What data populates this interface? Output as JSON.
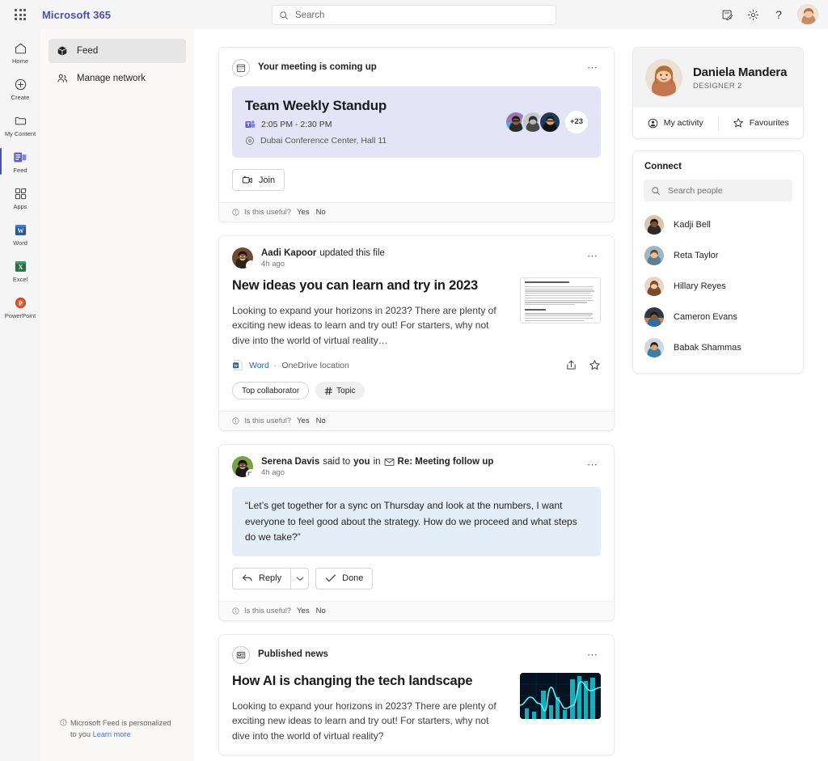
{
  "header": {
    "brand": "Microsoft 365",
    "waffle_label": "app-launcher",
    "search_placeholder": "Search",
    "search_value": "",
    "icons": {
      "feedback": "note-edit-icon",
      "settings": "gear-icon",
      "help": "help-icon",
      "avatar": "user-avatar"
    }
  },
  "rail": {
    "items": [
      {
        "label": "Home",
        "icon": "home-icon"
      },
      {
        "label": "Create",
        "icon": "plus-circle-icon"
      },
      {
        "label": "My Content",
        "icon": "folder-icon"
      },
      {
        "label": "Feed",
        "icon": "feed-icon"
      },
      {
        "label": "Apps",
        "icon": "apps-grid-icon"
      },
      {
        "label": "Word",
        "icon": "word-icon"
      },
      {
        "label": "Excel",
        "icon": "excel-icon"
      },
      {
        "label": "PowerPoint",
        "icon": "powerpoint-icon"
      }
    ],
    "active_index": 3
  },
  "nav": {
    "items": [
      {
        "label": "Feed",
        "icon": "cube-icon",
        "selected": true
      },
      {
        "label": "Manage network",
        "icon": "people-icon",
        "selected": false
      }
    ],
    "footer_text": "Microsoft Feed is personalized to you",
    "footer_link": "Learn more"
  },
  "feed": {
    "meeting_card": {
      "header": "Your meeting is coming up",
      "header_icon": "calendar-icon",
      "title": "Team Weekly Standup",
      "time": "2:05 PM - 2:30 PM",
      "time_icon": "teams-icon",
      "location": "Dubai Conference Center, Hall 11",
      "location_icon": "location-pin-icon",
      "overflow_count": "+23",
      "join_label": "Join",
      "join_icon": "video-camera-icon",
      "feedback": {
        "prompt": "Is this useful?",
        "yes": "Yes",
        "no": "No"
      },
      "accent_bg": "#e4e4f6"
    },
    "file_card": {
      "actor": "Aadi Kapoor",
      "action": "updated this file",
      "time": "4h ago",
      "badge_icon": "pencil-icon",
      "title": "New ideas you can learn and try in 2023",
      "description": "Looking to expand your horizons in 2023? There are plenty of exciting new ideas to learn and try out! For starters, why not dive into the world of virtual reality…",
      "app_name": "Word",
      "app_icon": "word-icon",
      "separator": "·",
      "location": "OneDrive location",
      "actions": {
        "share": "share-icon",
        "favourite": "star-icon"
      },
      "chips": [
        {
          "label": "Top collaborator",
          "style": "outline"
        },
        {
          "label": "Topic",
          "style": "filled",
          "icon": "hash-icon"
        }
      ],
      "feedback": {
        "prompt": "Is this useful?",
        "yes": "Yes",
        "no": "No"
      }
    },
    "email_card": {
      "actor": "Serena Davis",
      "verb": "said to",
      "target": "you",
      "preposition": "in",
      "subject_icon": "mail-icon",
      "subject": "Re: Meeting follow up",
      "time": "4h ago",
      "badge_icon": "comment-icon",
      "quote": "“Let’s get together for a sync on Thursday and look at the numbers, I want everyone to feel good about the strategy. How do we proceed and what steps do we take?”",
      "quote_bg": "#e4eef9",
      "reply_label": "Reply",
      "reply_icon": "reply-arrow-icon",
      "reply_chevron": "chevron-down-icon",
      "done_label": "Done",
      "done_icon": "checkmark-icon",
      "feedback": {
        "prompt": "Is this useful?",
        "yes": "Yes",
        "no": "No"
      }
    },
    "news_card": {
      "header": "Published news",
      "header_icon": "news-icon",
      "title": "How AI is changing the tech landscape",
      "description": "Looking to expand your horizons in 2023? There are plenty of exciting new ideas to learn and try out! For starters, why not dive into the world of virtual reality?",
      "thumbnail": "data-chart-image"
    }
  },
  "profile": {
    "name": "Daniela Mandera",
    "role": "DESIGNER 2",
    "activity_label": "My activity",
    "activity_icon": "person-circle-icon",
    "favourites_label": "Favourites",
    "favourites_icon": "star-icon"
  },
  "connect": {
    "title": "Connect",
    "search_placeholder": "Search people",
    "search_value": "",
    "people": [
      {
        "name": "Kadji Bell"
      },
      {
        "name": "Reta Taylor"
      },
      {
        "name": "Hillary Reyes"
      },
      {
        "name": "Cameron Evans"
      },
      {
        "name": "Babak Shammas"
      }
    ]
  },
  "colors": {
    "brand": "#4a4fb8",
    "link": "#2a65c8",
    "meeting_bg": "#e4e4f6",
    "quote_bg": "#e4eef9"
  }
}
